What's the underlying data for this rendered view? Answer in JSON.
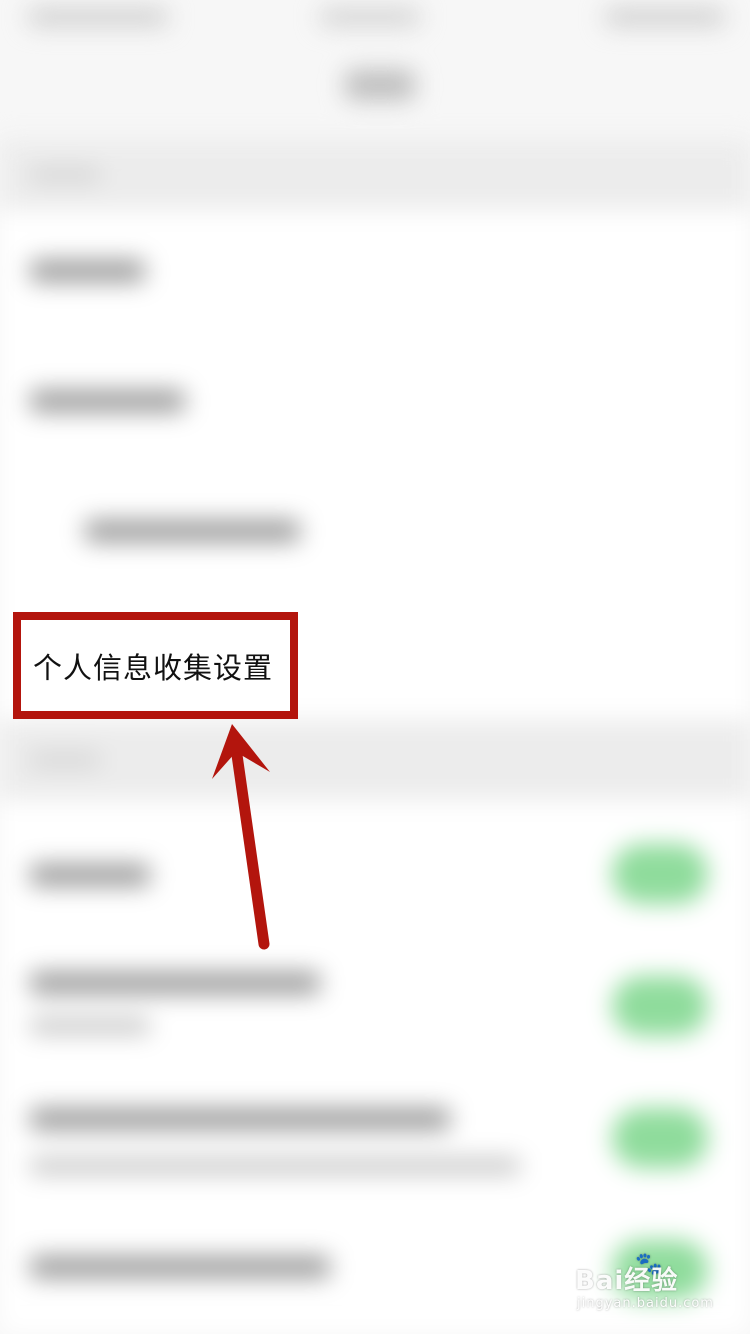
{
  "highlight": {
    "label": "个人信息收集设置"
  },
  "annotation": {
    "box_color": "#b3150d",
    "arrow_color": "#b3150d"
  },
  "toggles": [
    {
      "state": "on",
      "color": "#8fdc9c"
    },
    {
      "state": "on",
      "color": "#8fdc9c"
    },
    {
      "state": "on",
      "color": "#8fdc9c"
    },
    {
      "state": "on",
      "color": "#8fdc9c"
    }
  ],
  "watermark": {
    "logo": "Bai经验",
    "sub": "jingyan.baidu.com",
    "paw_icon": "baidu-paw-icon"
  }
}
